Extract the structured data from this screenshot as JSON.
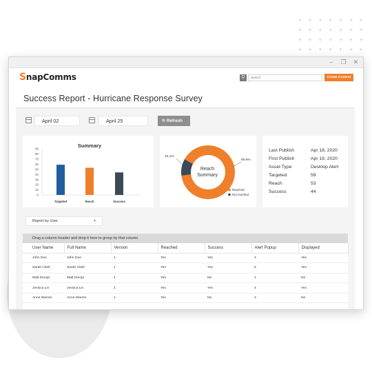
{
  "brand": {
    "logo_initial": "S",
    "logo_rest": "napComms",
    "accent": "#f07f2b"
  },
  "window_controls": {
    "minimize": "–",
    "restore": "❐",
    "close": "✕"
  },
  "header": {
    "search_placeholder": "Search",
    "create_label": "Create Content"
  },
  "page": {
    "title": "Success Report - Hurricane Response Survey"
  },
  "filters": {
    "start_date": "April 02",
    "end_date": "April 25",
    "refresh_label": "Refresh"
  },
  "summary_chart": {
    "title": "Summary",
    "ticks": [
      "0",
      "10",
      "20",
      "30",
      "40",
      "50",
      "60",
      "70",
      "80",
      "90"
    ]
  },
  "chart_data": [
    {
      "type": "bar",
      "title": "Summary",
      "categories": [
        "Targeted",
        "Reach",
        "Success"
      ],
      "values": [
        59,
        53,
        44
      ],
      "colors": [
        "#1f5f9e",
        "#f07f2b",
        "#3c4a57"
      ],
      "ylim": [
        0,
        90
      ],
      "grid": false
    },
    {
      "type": "pie",
      "title": "Reach Summary",
      "slices": [
        {
          "label": "Reached",
          "value": 89.9,
          "display": "89,9%",
          "color": "#f07f2b"
        },
        {
          "label": "Not reached",
          "value": 10.1,
          "display": "10,1%",
          "color": "#3c4a57"
        }
      ],
      "legend": "bottom-right"
    }
  ],
  "reach_chart": {
    "title_line1": "Reach",
    "title_line2": "Summary"
  },
  "info": [
    {
      "label": "Last Publish",
      "value": "Apr 18, 2020"
    },
    {
      "label": "First Publish",
      "value": "Apr 18, 2020"
    },
    {
      "label": "Asset Type",
      "value": "Desktop Alert"
    },
    {
      "label": "Targeted",
      "value": "59"
    },
    {
      "label": "Reach",
      "value": "53"
    },
    {
      "label": "Success",
      "value": "44"
    }
  ],
  "report": {
    "dropdown_label": "Report by User",
    "group_hint": "Drag a column header and drop it here to group by that column",
    "columns": [
      "User Name",
      "Full Name",
      "Version",
      "Reached",
      "Success",
      "Alert Popup",
      "Displayed"
    ],
    "rows": [
      [
        "John Doe",
        "John Doe",
        "1",
        "Yes",
        "Yes",
        "3",
        "Yes"
      ],
      [
        "Sarah Clark",
        "Sarah Clark",
        "1",
        "Yes",
        "Yes",
        "6",
        "Yes"
      ],
      [
        "Matt Dinopt",
        "Matt Dinopt",
        "1",
        "Yes",
        "No",
        "1",
        "No"
      ],
      [
        "Jessica Lin",
        "Jessica Lin",
        "1",
        "Yes",
        "Yes",
        "4",
        "Yes"
      ],
      [
        "Anne Warren",
        "Anne Warren",
        "1",
        "Yes",
        "No",
        "3",
        "No"
      ]
    ]
  }
}
